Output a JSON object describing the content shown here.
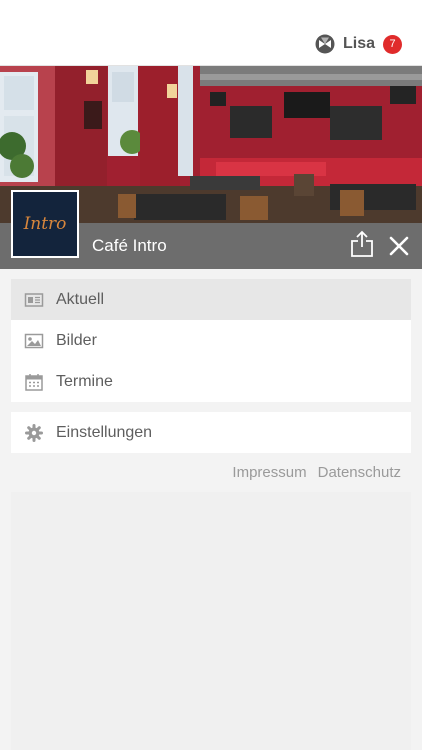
{
  "header": {
    "user_name": "Lisa",
    "notification_count": "7",
    "user_icon": "globe-logo-icon"
  },
  "venue": {
    "name": "Café Intro",
    "logo_text": "Intro",
    "share_icon": "share-icon",
    "close_icon": "close-icon"
  },
  "menu": {
    "primary": [
      {
        "label": "Aktuell",
        "icon": "newspaper-icon",
        "active": true
      },
      {
        "label": "Bilder",
        "icon": "image-icon",
        "active": false
      },
      {
        "label": "Termine",
        "icon": "calendar-icon",
        "active": false
      }
    ],
    "secondary": [
      {
        "label": "Einstellungen",
        "icon": "gear-icon",
        "active": false
      }
    ]
  },
  "footer": {
    "impressum": "Impressum",
    "datenschutz": "Datenschutz"
  },
  "colors": {
    "badge": "#e02b2b",
    "logo_background": "#13243c",
    "logo_text": "#d7863c",
    "venue_bar": "#6d6d6d",
    "active_item": "#e7e7e7"
  }
}
